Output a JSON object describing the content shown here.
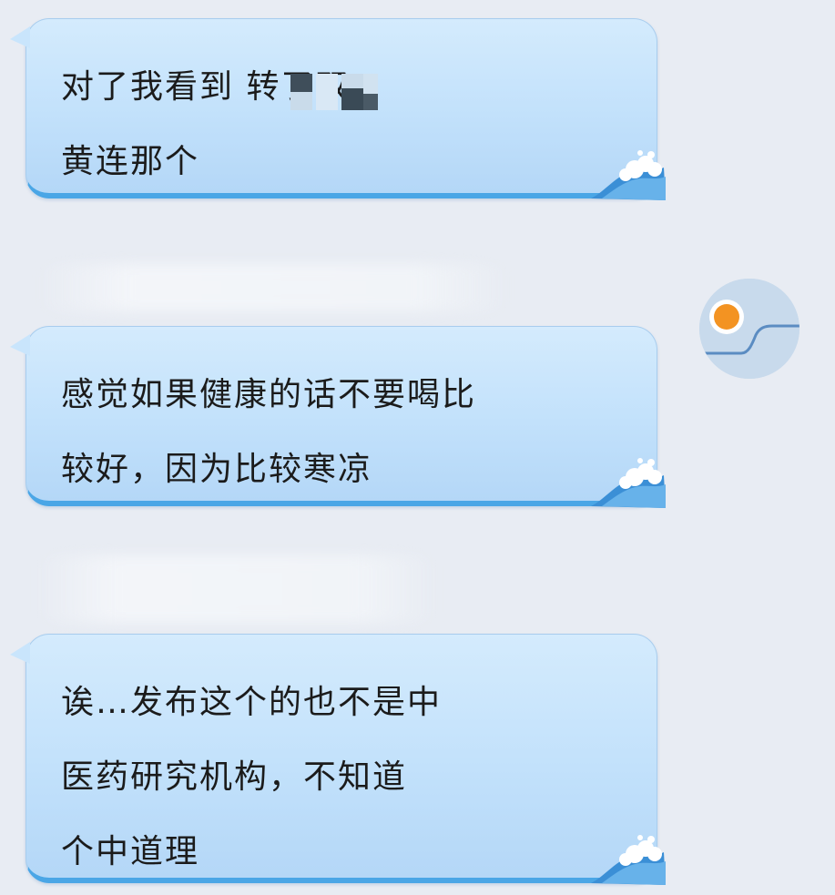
{
  "messages": [
    {
      "text": "对了我看到          转了双\n黄连那个"
    },
    {
      "text": "感觉如果健康的话不要喝比\n较好，因为比较寒凉"
    },
    {
      "text": "诶…发布这个的也不是中\n医药研究机构，不知道\n个中道理"
    }
  ],
  "colors": {
    "background": "#e8ecf3",
    "bubble_fill": "#c6e3fb",
    "bubble_bottom_border": "#4aa6e6",
    "avatar_dot": "#f39322",
    "avatar_bg": "#c8daec"
  },
  "icons": {
    "bubble_decoration": "wave-icon",
    "avatar": "avatar-placeholder-icon"
  }
}
